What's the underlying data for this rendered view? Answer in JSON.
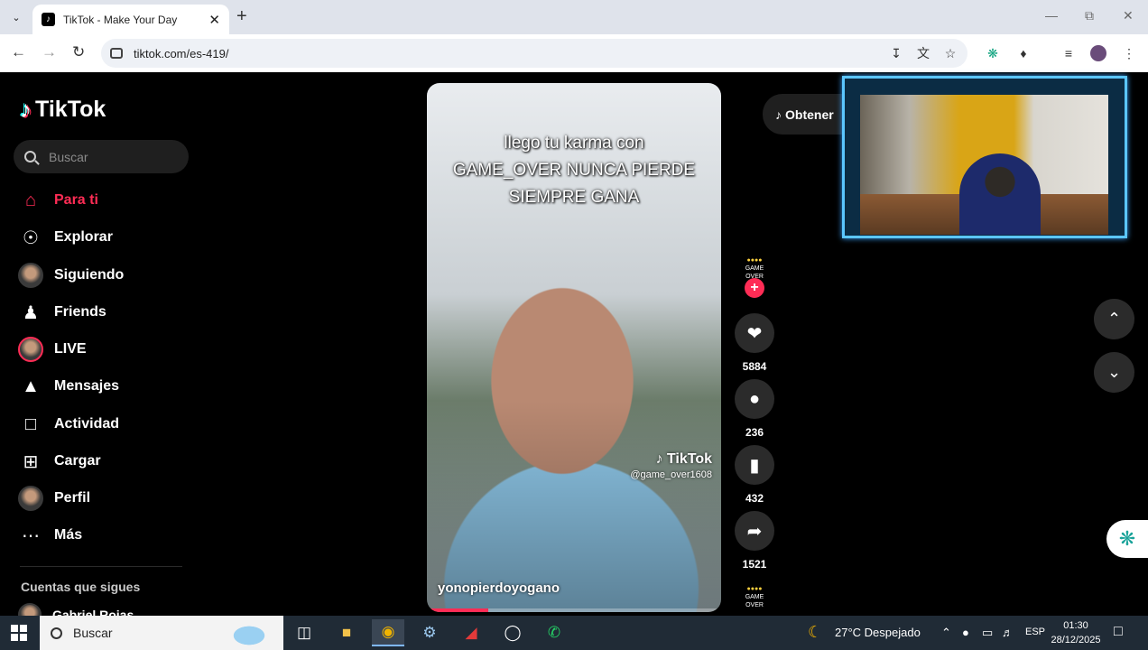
{
  "browser": {
    "tab_title": "TikTok - Make Your Day",
    "url": "tiktok.com/es-419/"
  },
  "tiktok": {
    "brand": "TikTok",
    "search_placeholder": "Buscar",
    "nav": [
      {
        "label": "Para ti",
        "icon": "home-icon",
        "active": true
      },
      {
        "label": "Explorar",
        "icon": "compass-icon"
      },
      {
        "label": "Siguiendo",
        "icon": "following-avatar"
      },
      {
        "label": "Friends",
        "icon": "friends-icon"
      },
      {
        "label": "LIVE",
        "icon": "live-avatar"
      },
      {
        "label": "Mensajes",
        "icon": "send-icon"
      },
      {
        "label": "Actividad",
        "icon": "activity-icon"
      },
      {
        "label": "Cargar",
        "icon": "upload-icon"
      },
      {
        "label": "Perfil",
        "icon": "profile-avatar"
      },
      {
        "label": "Más",
        "icon": "more-icon"
      }
    ],
    "following_title": "Cuentas que sigues",
    "following_users": [
      {
        "name": "Gabriel Rojas"
      }
    ],
    "get_app_label": "Obtener",
    "video": {
      "caption_lines": [
        "llego tu karma con",
        "GAME_OVER NUNCA PIERDE",
        "SIEMPRE GANA"
      ],
      "watermark_brand": "TikTok",
      "watermark_user": "@game_over1608",
      "author": "yonopierdoyogano",
      "progress_fraction": 0.21
    },
    "actions": {
      "likes": "5884",
      "comments": "236",
      "saves": "432",
      "shares": "1521"
    },
    "creator_badge": "GAME OVER"
  },
  "taskbar": {
    "search_label": "Buscar",
    "weather": "27°C  Despejado",
    "lang": "ESP",
    "time": "01:30",
    "date": "28/12/2025"
  },
  "colors": {
    "accent": "#fe2c55",
    "cam_border": "#5bc6ff"
  }
}
